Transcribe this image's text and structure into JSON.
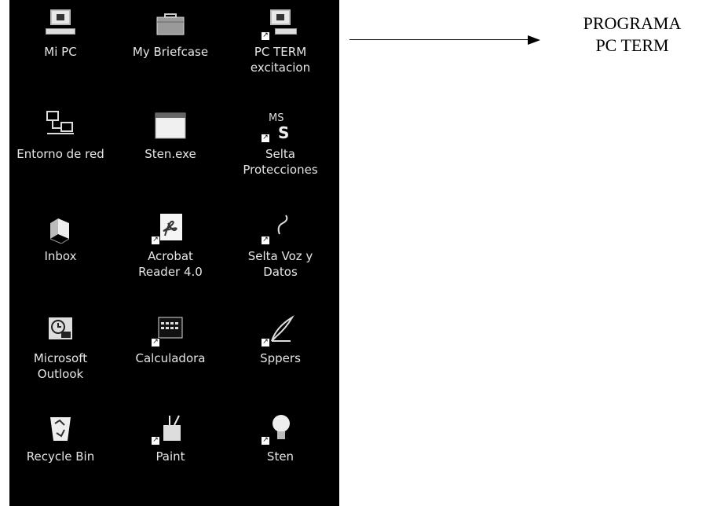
{
  "desktop": {
    "icons": [
      {
        "label": "Mi PC",
        "icon": "computer-icon"
      },
      {
        "label": "My Briefcase",
        "icon": "briefcase-icon"
      },
      {
        "label": "PC TERM\nexcitacion",
        "icon": "pc-term-icon",
        "shortcut": true
      },
      {
        "label": "Entorno de red",
        "icon": "network-icon"
      },
      {
        "label": "Sten.exe",
        "icon": "window-icon"
      },
      {
        "label": "Selta\nProtecciones",
        "icon": "ms-s-icon",
        "shortcut": true
      },
      {
        "label": "Inbox",
        "icon": "inbox-icon"
      },
      {
        "label": "Acrobat\nReader 4.0",
        "icon": "acrobat-icon",
        "shortcut": true
      },
      {
        "label": "Selta Voz y\nDatos",
        "icon": "selta-voz-icon",
        "shortcut": true
      },
      {
        "label": "Microsoft\nOutlook",
        "icon": "outlook-icon"
      },
      {
        "label": "Calculadora",
        "icon": "calculator-icon",
        "shortcut": true
      },
      {
        "label": "Sppers",
        "icon": "quill-icon",
        "shortcut": true
      },
      {
        "label": "Recycle Bin",
        "icon": "recycle-bin-icon"
      },
      {
        "label": "Paint",
        "icon": "paint-icon",
        "shortcut": true
      },
      {
        "label": "Sten",
        "icon": "lightbulb-icon",
        "shortcut": true
      }
    ]
  },
  "callout": {
    "line1": "PROGRAMA",
    "line2": "PC TERM"
  },
  "colors": {
    "desktop_bg": "#000000",
    "label_text": "#e6e6e6"
  }
}
